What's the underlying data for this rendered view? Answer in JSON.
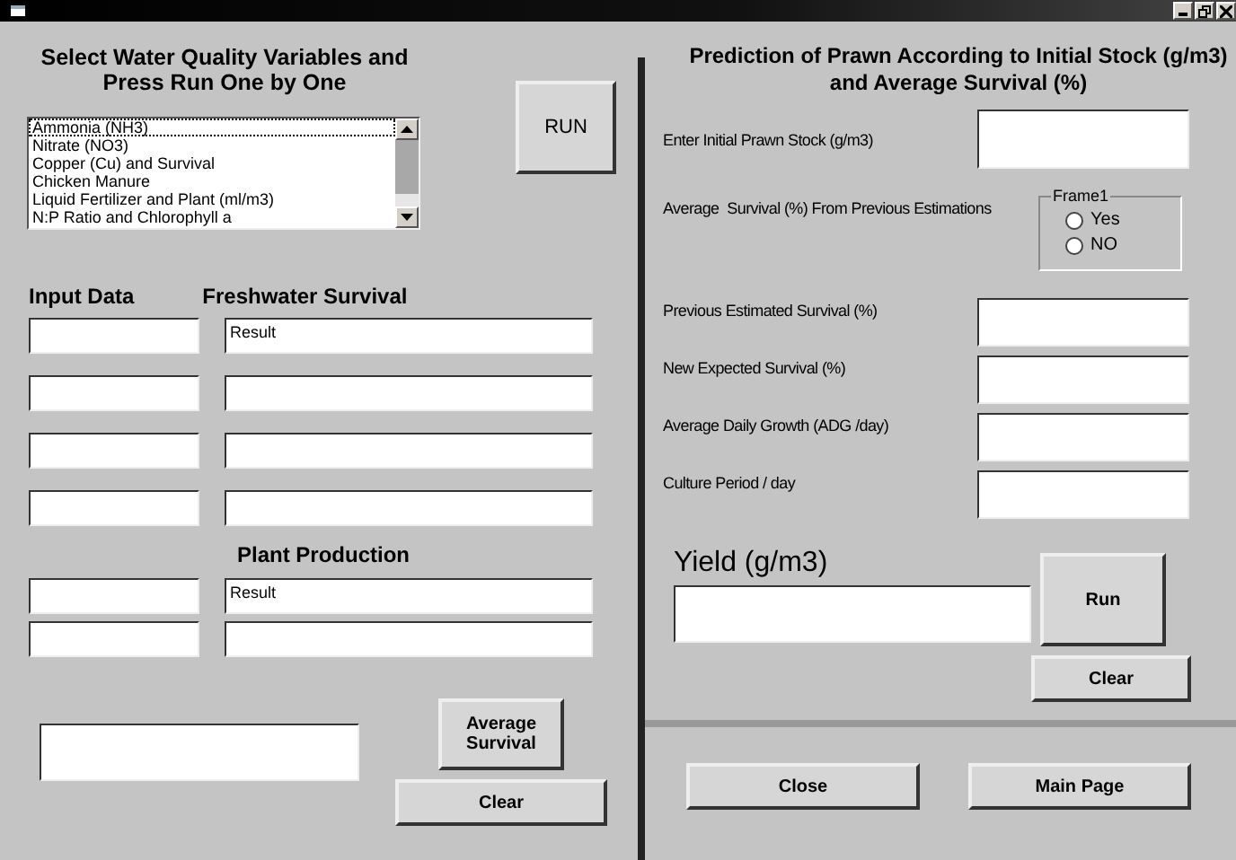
{
  "left": {
    "heading": "Select Water Quality Variables and Press Run One by One",
    "run_button": "RUN",
    "list": {
      "items": [
        {
          "label": "Ammonia (NH3)",
          "focused": true
        },
        {
          "label": "Nitrate (NO3)",
          "focused": false
        },
        {
          "label": "Copper (Cu) and Survival",
          "focused": false
        },
        {
          "label": "Chicken Manure",
          "focused": false
        },
        {
          "label": "Liquid Fertilizer and Plant (ml/m3)",
          "focused": false
        },
        {
          "label": "N:P Ratio and Chlorophyll a",
          "focused": false
        }
      ]
    },
    "input_heading": "Input Data",
    "freshwater_heading": "Freshwater Survival",
    "freshwater_rows": [
      {
        "result": "Result"
      },
      {},
      {},
      {}
    ],
    "plant_heading": "Plant Production",
    "plant_rows": [
      {
        "result": "Result"
      },
      {}
    ],
    "average_button": "Average Survival",
    "clear_button": "Clear"
  },
  "right": {
    "heading": "Prediction of Prawn According to Initial Stock (g/m3) and Average Survival (%)",
    "stock_label": "Enter Initial Prawn Stock (g/m3)",
    "average_label": "Average  Survival (%) From Previous Estimations",
    "frame": {
      "title": "Frame1",
      "options": [
        {
          "label": "Yes",
          "selected": false
        },
        {
          "label": "NO",
          "selected": false
        }
      ]
    },
    "fields": [
      {
        "label": "Previous Estimated Survival (%)"
      },
      {
        "label": "New Expected Survival (%)"
      },
      {
        "label": "Average Daily Growth (ADG /day)"
      },
      {
        "label": "Culture Period / day"
      }
    ],
    "yield_label": "Yield (g/m3)",
    "run_button": "Run",
    "clear_button": "Clear",
    "close_button": "Close",
    "main_page_button": "Main Page"
  }
}
